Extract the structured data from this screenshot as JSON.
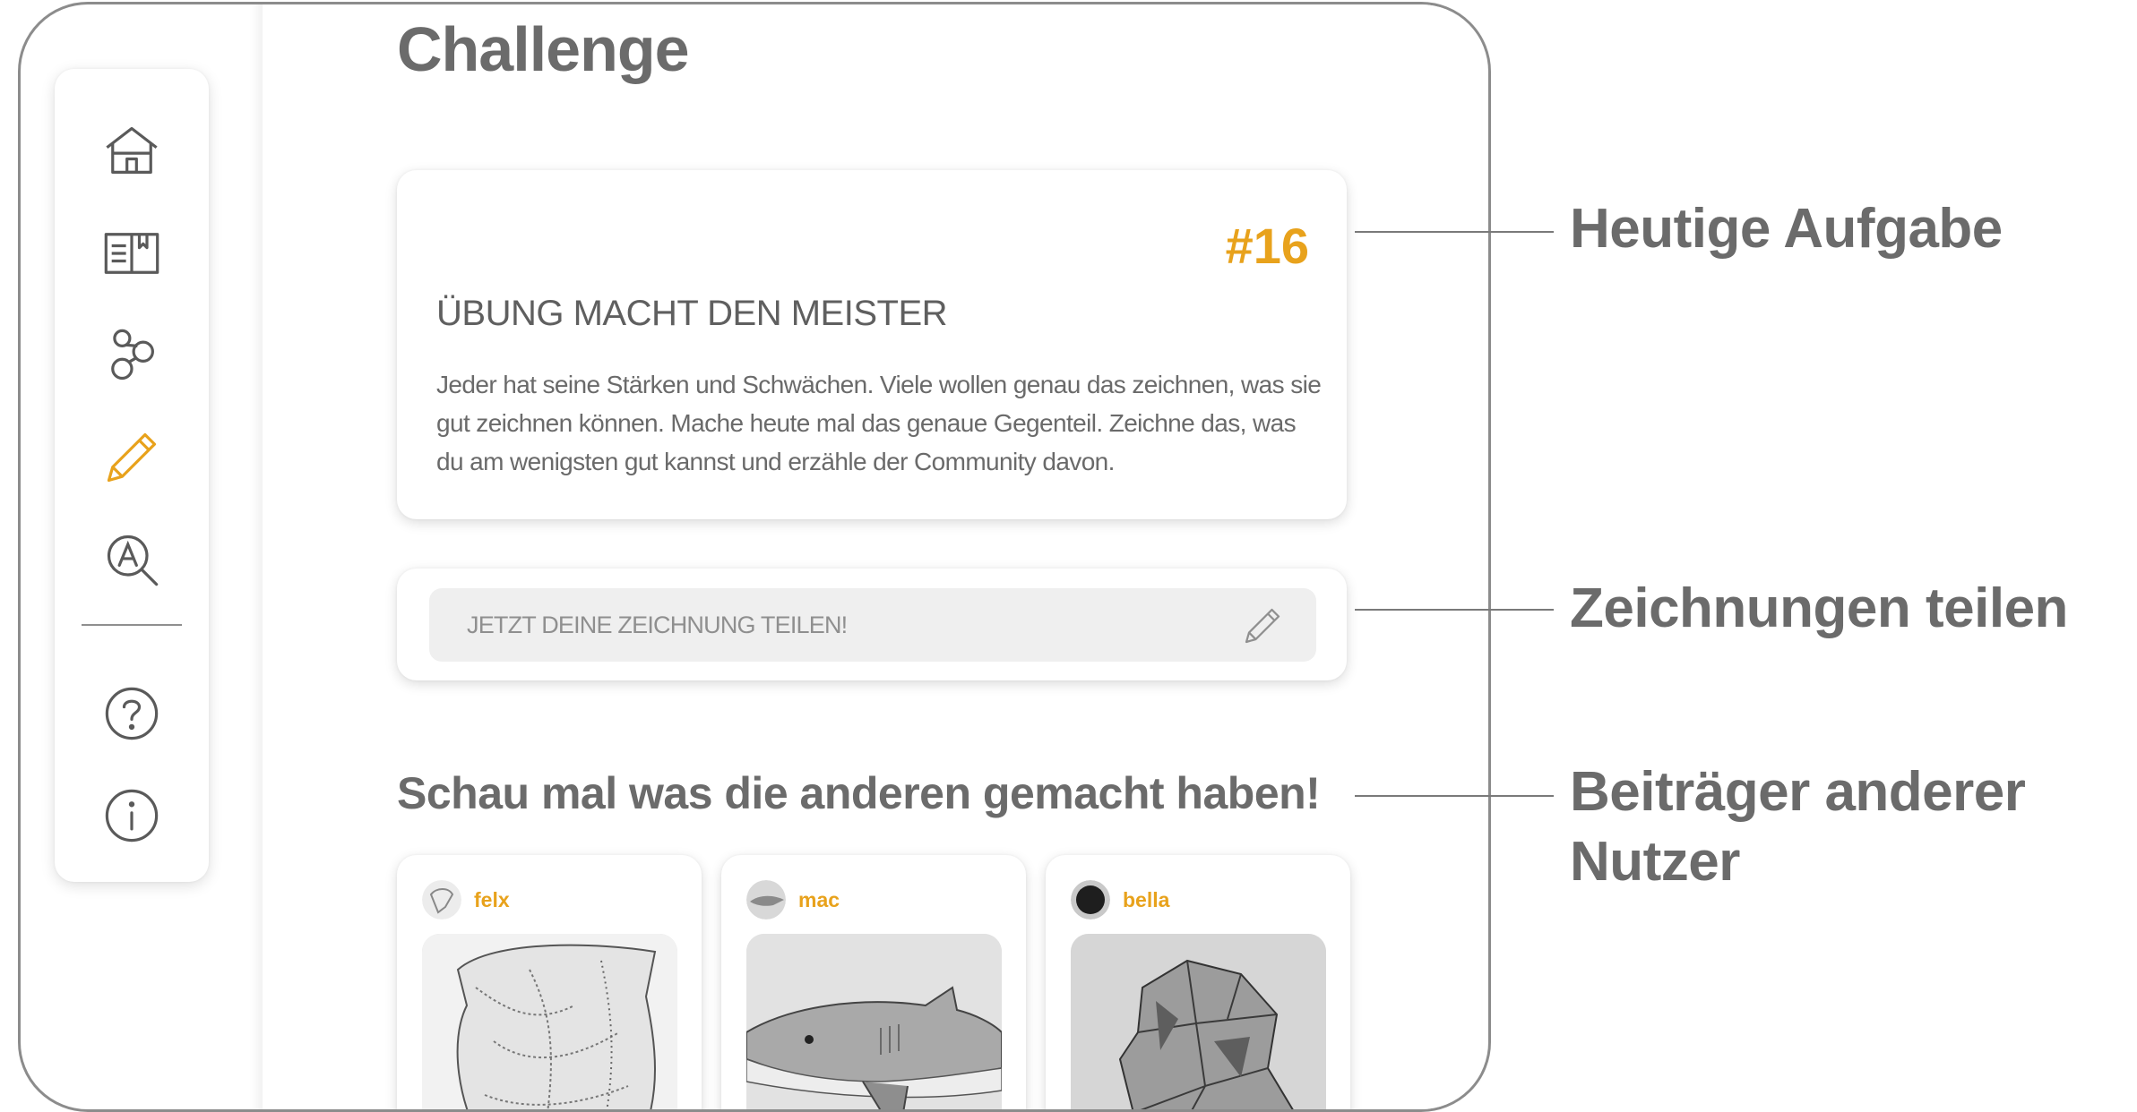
{
  "page": {
    "title": "Challenge"
  },
  "sidebar": {
    "items": [
      {
        "id": "home",
        "icon": "home-icon"
      },
      {
        "id": "journal",
        "icon": "book-icon"
      },
      {
        "id": "community",
        "icon": "bubbles-icon"
      },
      {
        "id": "challenge",
        "icon": "pencil-icon",
        "active": true
      },
      {
        "id": "search",
        "icon": "search-letter-icon"
      }
    ],
    "bottom_items": [
      {
        "id": "help",
        "icon": "question-icon"
      },
      {
        "id": "info",
        "icon": "info-icon"
      }
    ],
    "active_color": "#E8A21C",
    "icon_color": "#5A5A5A"
  },
  "task": {
    "number": "#16",
    "title": "ÜBUNG MACHT DEN MEISTER",
    "description": "Jeder hat seine Stärken und Schwächen. Viele wollen genau das zeichnen, was sie gut zeichnen können. Mache heute mal das genaue Gegenteil. Zeichne das, was du am wenigsten gut kannst und erzähle der Community davon."
  },
  "share": {
    "placeholder": "JETZT DEINE ZEICHNUNG TEILEN!",
    "icon": "pencil-icon"
  },
  "community": {
    "heading": "Schau mal was die anderen gemacht haben!",
    "posts": [
      {
        "user": "felx",
        "image": "sketch-bag"
      },
      {
        "user": "mac",
        "image": "sketch-shark"
      },
      {
        "user": "bella",
        "image": "sketch-crumpled-paper"
      }
    ]
  },
  "callouts": [
    {
      "label": "Heutige Aufgabe"
    },
    {
      "label": "Zeichnungen teilen"
    },
    {
      "label": "Beiträger anderer Nutzer"
    }
  ],
  "colors": {
    "accent": "#E8A21C",
    "text": "#6B6B6B",
    "input_bg": "#EFEFEF"
  }
}
